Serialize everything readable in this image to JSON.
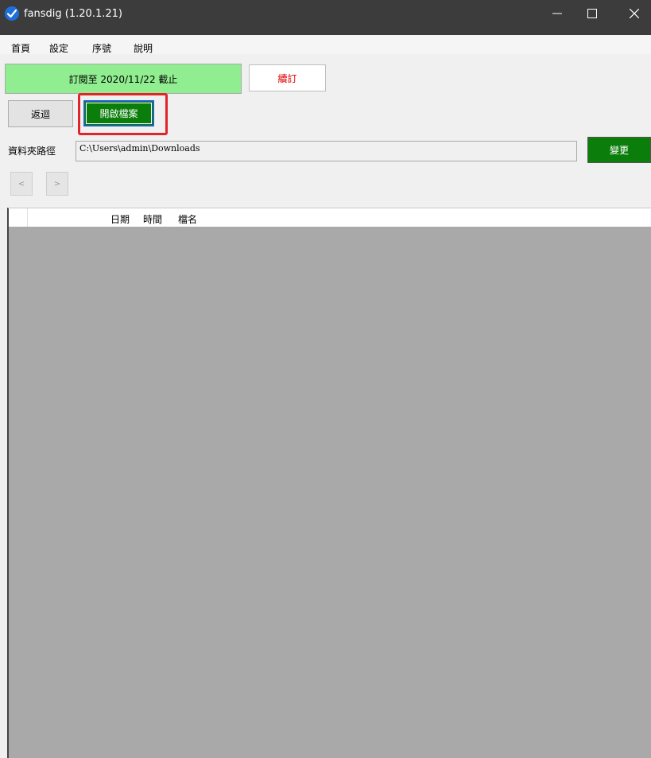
{
  "window": {
    "title": "fansdig (1.20.1.21)",
    "app_icon": "checkmark-app-icon",
    "controls": {
      "minimize": "—",
      "maximize": "☐",
      "close": "✕"
    }
  },
  "menu": [
    "首頁",
    "設定",
    "序號",
    "說明"
  ],
  "subscription": {
    "text": "訂閱至 2020/11/22 截止",
    "renew_label": "續訂"
  },
  "toolbar": {
    "back_label": "返迴",
    "open_label": "開啟檔案"
  },
  "path": {
    "label": "資料夾路徑",
    "value": "C:\\Users\\admin\\Downloads",
    "change_label": "變更"
  },
  "nav": {
    "prev": "<",
    "next": ">"
  },
  "list": {
    "columns": [
      "日期",
      "時間",
      "檔名"
    ]
  },
  "colors": {
    "accent_green": "#0a7d0a",
    "status_green": "#90ee90",
    "highlight_red": "#e3232c",
    "list_bg": "#a9a9a9"
  }
}
